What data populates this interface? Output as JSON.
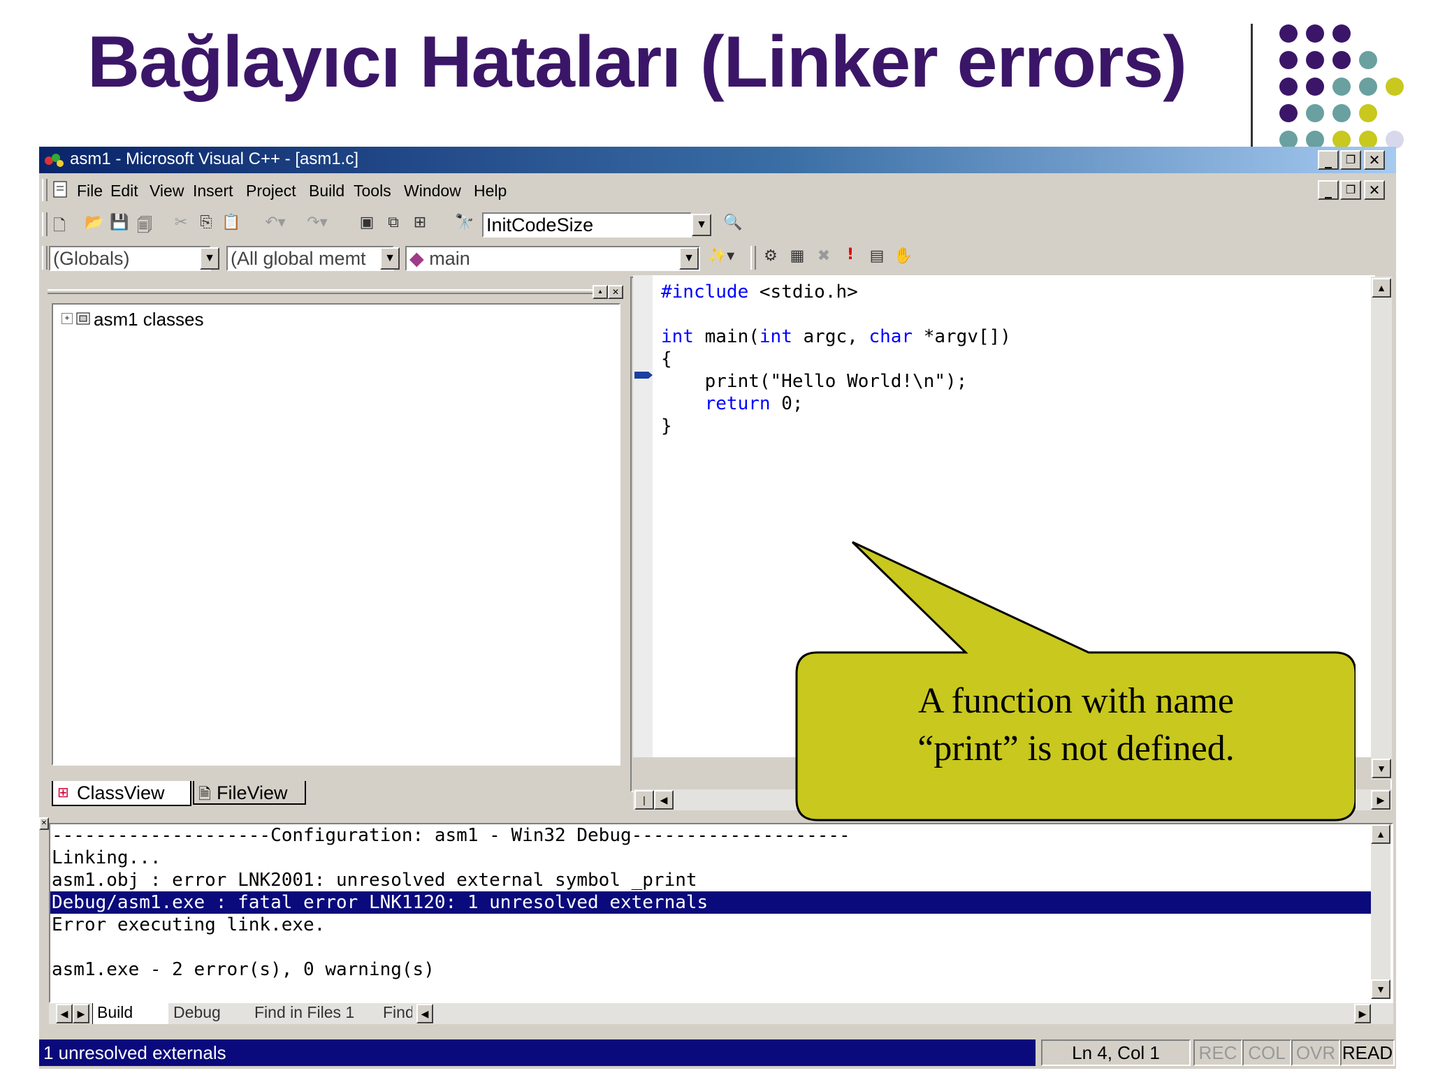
{
  "slide": {
    "title": "Bağlayıcı Hataları (Linker errors)",
    "dot_colors": [
      "#3b1668",
      "#6aa0a0",
      "#c8c81e",
      "#d8d8ec"
    ]
  },
  "window": {
    "title": "asm1 - Microsoft Visual C++ - [asm1.c]",
    "caption_buttons": [
      "_",
      "🗗",
      "✕"
    ]
  },
  "menu": {
    "items": [
      "File",
      "Edit",
      "View",
      "Insert",
      "Project",
      "Build",
      "Tools",
      "Window",
      "Help"
    ]
  },
  "toolbar": {
    "config_combo": "InitCodeSize",
    "globals_combo": "(Globals)",
    "members_combo": "(All global memt",
    "function_combo": "main"
  },
  "workspace": {
    "tree_root": "asm1 classes",
    "tabs": [
      "ClassView",
      "FileView"
    ]
  },
  "editor": {
    "lines": [
      {
        "kw": "#include",
        "rest": " <stdio.h>"
      },
      {
        "kw": "",
        "rest": ""
      },
      {
        "kw": "int",
        "rest": " main(",
        "kw2": "int",
        "rest2": " argc, ",
        "kw3": "char",
        "rest3": " *argv[])"
      },
      {
        "kw": "",
        "rest": "{"
      },
      {
        "kw": "",
        "rest": "    print(\"Hello World!\\n\");"
      },
      {
        "kw": "    return",
        "rest": " 0;"
      },
      {
        "kw": "",
        "rest": "}"
      }
    ]
  },
  "callout": {
    "line1": "A function with name",
    "line2": "“print” is not defined."
  },
  "output": {
    "lines": [
      "--------------------Configuration: asm1 - Win32 Debug--------------------",
      "Linking...",
      "asm1.obj : error LNK2001: unresolved external symbol _print",
      "Debug/asm1.exe : fatal error LNK1120: 1 unresolved externals",
      "Error executing link.exe.",
      "",
      "asm1.exe - 2 error(s), 0 warning(s)"
    ],
    "highlighted_line_index": 3,
    "tabs": [
      "Build",
      "Debug",
      "Find in Files 1",
      "Find"
    ]
  },
  "status": {
    "message": "1 unresolved externals",
    "position": "Ln 4, Col 1",
    "indicators": [
      "REC",
      "COL",
      "OVR",
      "READ"
    ]
  }
}
